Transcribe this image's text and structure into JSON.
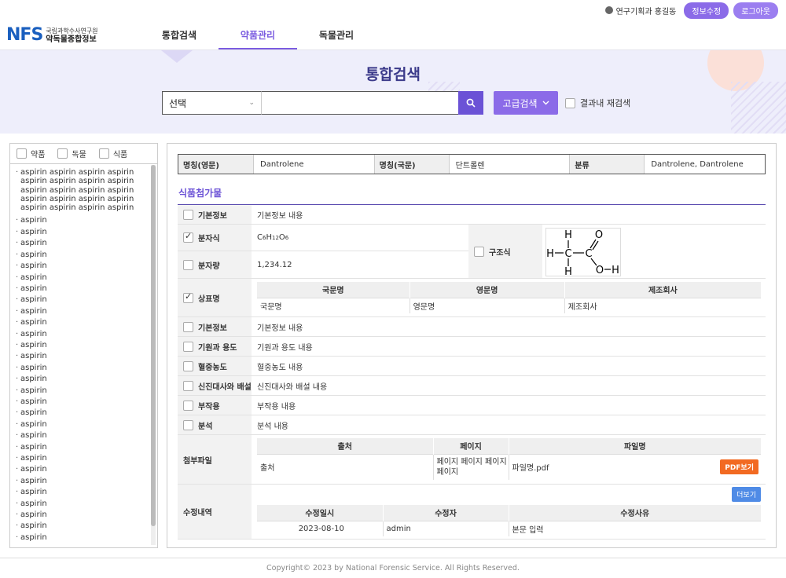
{
  "topbar": {
    "user_label": "연구기획과 홍길동",
    "edit_profile": "정보수정",
    "logout": "로그아웃"
  },
  "logo": {
    "mark": "NFS",
    "line1": "국립과학수사연구원",
    "line2": "약독물종합정보"
  },
  "nav": {
    "items": [
      {
        "label": "통합검색"
      },
      {
        "label": "약품관리"
      },
      {
        "label": "독물관리"
      }
    ]
  },
  "hero": {
    "title": "통합검색",
    "select_value": "선택",
    "search_placeholder": "",
    "advanced_label": "고급검색",
    "research_label": "결과내 재검색"
  },
  "sidebar": {
    "filters": [
      {
        "label": "약품"
      },
      {
        "label": "독물"
      },
      {
        "label": "식품"
      }
    ],
    "first_item": "aspirin aspirin aspirin aspirin aspirin aspirin aspirin aspirin aspirin aspirin aspirin aspirin aspirin aspirin aspirin aspirin aspirin aspirin aspirin aspirin",
    "items": [
      "aspirin",
      "aspirin",
      "aspirin",
      "aspirin",
      "aspirin",
      "aspirin",
      "aspirin",
      "aspirin",
      "aspirin",
      "aspirin",
      "aspirin",
      "aspirin",
      "aspirin",
      "aspirin",
      "aspirin",
      "aspirin",
      "aspirin",
      "aspirin",
      "aspirin",
      "aspirin",
      "aspirin",
      "aspirin",
      "aspirin",
      "aspirin",
      "aspirin",
      "aspirin",
      "aspirin",
      "aspirin",
      "aspirin"
    ]
  },
  "summary": {
    "name_en_label": "명칭(영문)",
    "name_en": "Dantrolene",
    "name_ko_label": "명칭(국문)",
    "name_ko": "단트롤렌",
    "class_label": "분류",
    "class_value": "Dantrolene, Dantrolene"
  },
  "section_title": "식품첨가물",
  "details": {
    "basic_label": "기본정보",
    "basic_value": "기본정보 내용",
    "formula_label": "분자식",
    "formula_parts": {
      "c": "C",
      "c_n": "6",
      "h": "H",
      "h_n": "12",
      "o": "O",
      "o_n": "6"
    },
    "mass_label": "분자량",
    "mass_value": "1,234.12",
    "structure_label": "구조식",
    "structure_atoms": {
      "h1": "H",
      "h2": "H",
      "h3": "H",
      "c1": "C",
      "c2": "C",
      "o1": "O",
      "o2": "O",
      "h4": "H"
    },
    "trademark_label": "상표명",
    "trademark_headers": [
      "국문명",
      "영문명",
      "제조회사"
    ],
    "trademark_row": [
      "국문명",
      "영문명",
      "제조회사"
    ],
    "rows": [
      {
        "label": "기본정보",
        "value": "기본정보 내용"
      },
      {
        "label": "기원과 용도",
        "value": "기원과 용도 내용"
      },
      {
        "label": "혈중농도",
        "value": "혈중농도 내용"
      },
      {
        "label": "신진대사와 배설",
        "value": "신진대사와 배설 내용"
      },
      {
        "label": "부작용",
        "value": "부작용 내용"
      },
      {
        "label": "분석",
        "value": "분석 내용"
      }
    ],
    "attach_label": "첨부파일",
    "attach_headers": [
      "출처",
      "페이지",
      "파일명"
    ],
    "attach_row": {
      "source": "출처",
      "page": "페이지 페이지 페이지 페이지",
      "file": "파일명.pdf",
      "pdf_button": "PDF보기"
    },
    "history_label": "수정내역",
    "more_button": "더보기",
    "history_headers": [
      "수정일시",
      "수정자",
      "수정사유"
    ],
    "history_row": [
      "2023-08-10",
      "admin",
      "본문 입력"
    ]
  },
  "footer": "Copyright© 2023 by National Forensic Service. All Rights Reserved.",
  "colors": {
    "accent": "#8b6be8",
    "nav_active": "#7b5ce0",
    "brand_blue": "#1a5fbf",
    "pdf": "#f26a22",
    "more": "#4f8be6"
  }
}
